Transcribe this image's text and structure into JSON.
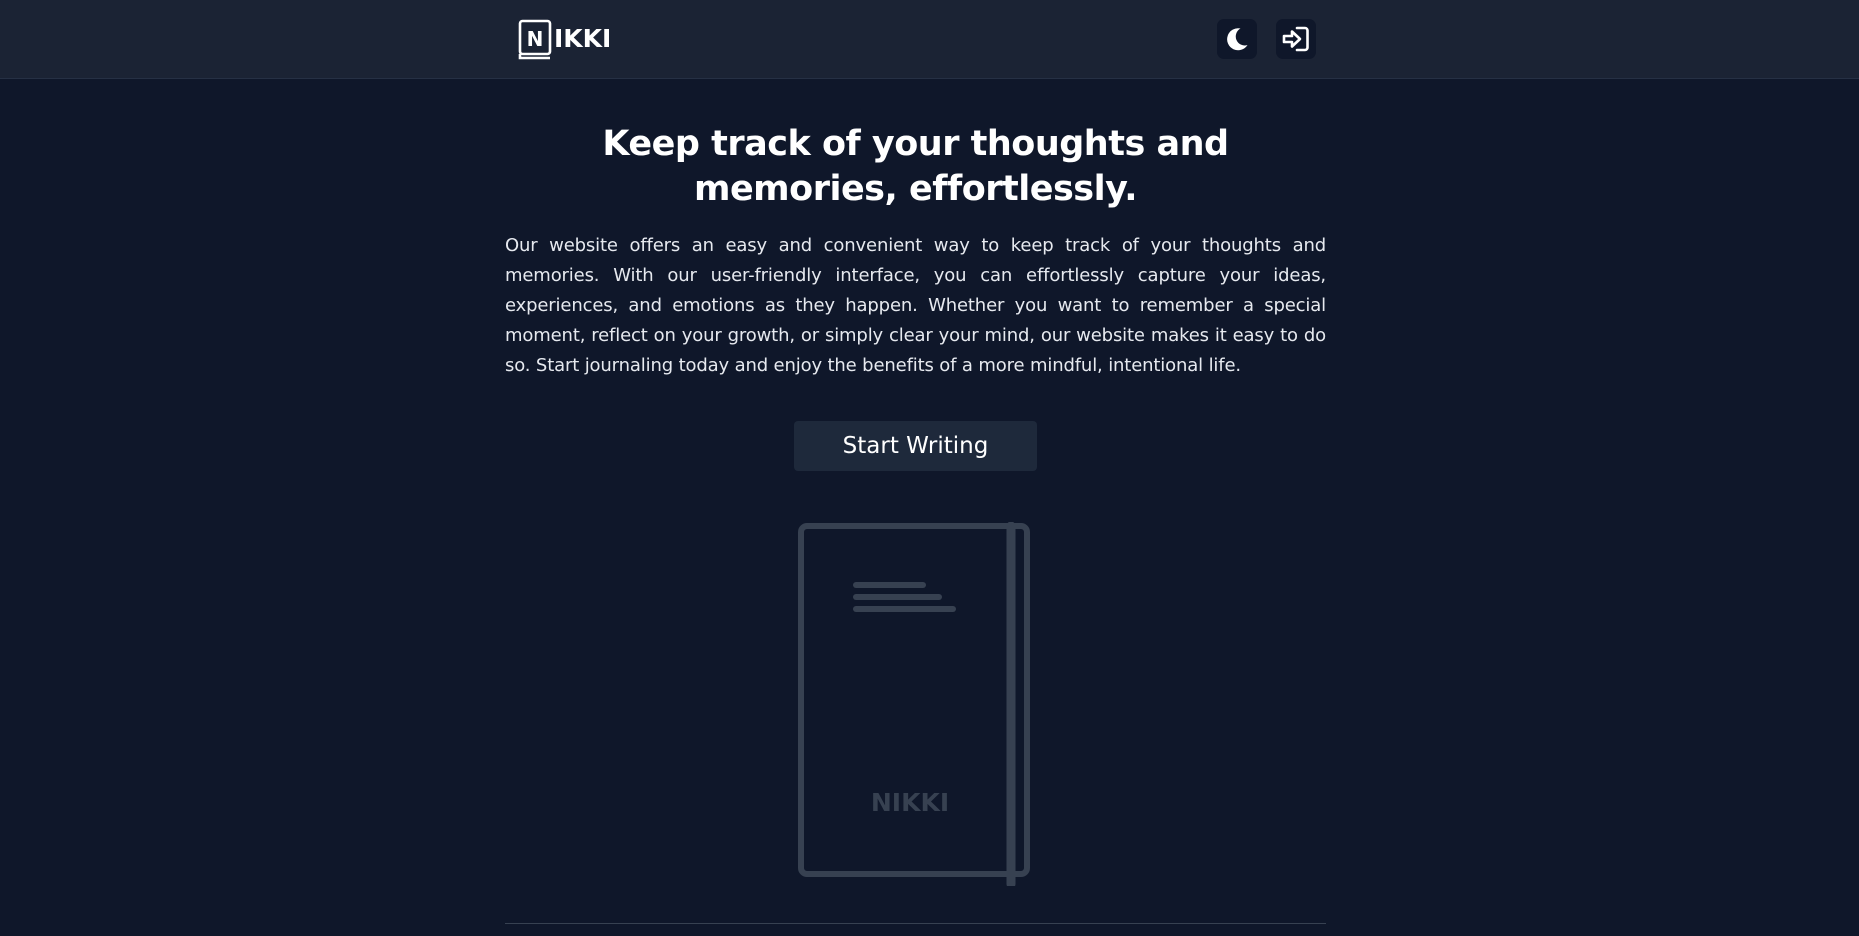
{
  "app": {
    "logo_text": "IKKI",
    "logo_letter": "N"
  },
  "navbar": {
    "theme_toggle_icon": "moon-icon",
    "login_icon": "sign-in-icon"
  },
  "hero": {
    "headline": "Keep track of your thoughts and memories, effortlessly.",
    "description": "Our website offers an easy and convenient way to keep track of your thoughts and memories. With our user-friendly interface, you can effortlessly capture your ideas, experiences, and emotions as they happen. Whether you want to remember a special moment, reflect on your growth, or simply clear your mind, our website makes it easy to do so. Start journaling today and enjoy the benefits of a more mindful, intentional life.",
    "cta_label": "Start Writing"
  },
  "illustration": {
    "book_icon": "journal-book-illustration",
    "book_label": "NIKKI"
  },
  "colors": {
    "background": "#0f172a",
    "navbar": "#1b2334",
    "button": "#1e293b",
    "illustration_stroke": "#374151"
  }
}
